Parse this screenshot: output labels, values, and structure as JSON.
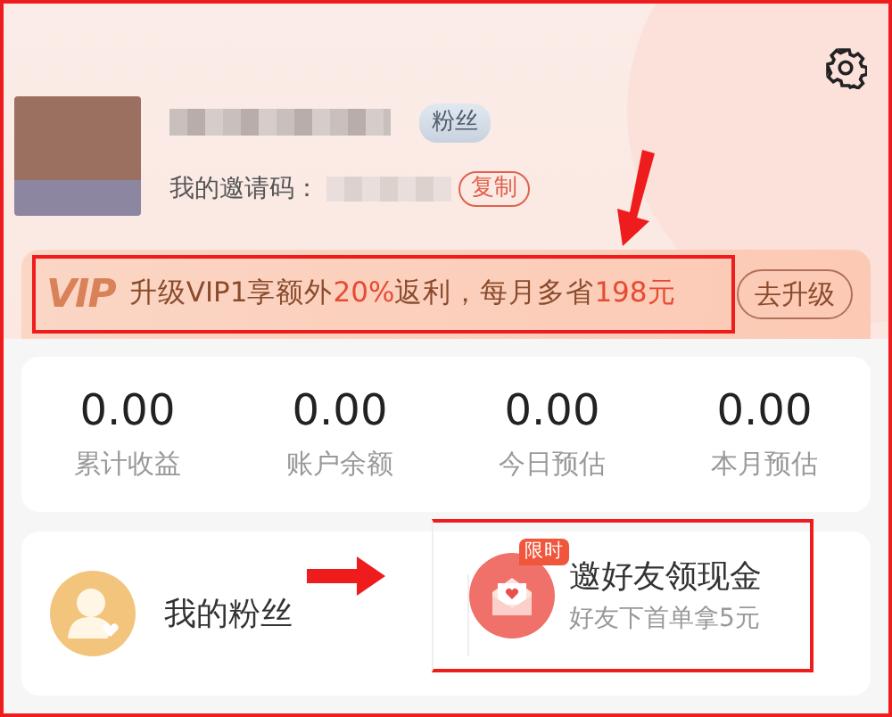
{
  "profile": {
    "fans_badge": "粉丝",
    "invite_label": "我的邀请码：",
    "copy_button": "复制"
  },
  "vip_banner": {
    "logo": "VIP",
    "annotated": true,
    "message": [
      {
        "text": "升级VIP1享额外",
        "highlight": false
      },
      {
        "text": "20%",
        "highlight": true
      },
      {
        "text": "返利，每月多省",
        "highlight": false
      },
      {
        "text": "198元",
        "highlight": true
      }
    ],
    "upgrade_button": "去升级"
  },
  "stats": [
    {
      "value": "0.00",
      "label": "累计收益"
    },
    {
      "value": "0.00",
      "label": "账户余额"
    },
    {
      "value": "0.00",
      "label": "今日预估"
    },
    {
      "value": "0.00",
      "label": "本月预估"
    }
  ],
  "shortcuts": [
    {
      "kind": "fans",
      "title": "我的粉丝"
    },
    {
      "kind": "invite",
      "title": "邀好友领现金",
      "subtitle": "好友下首单拿5元",
      "tag": "限时",
      "annotated": true
    }
  ]
}
